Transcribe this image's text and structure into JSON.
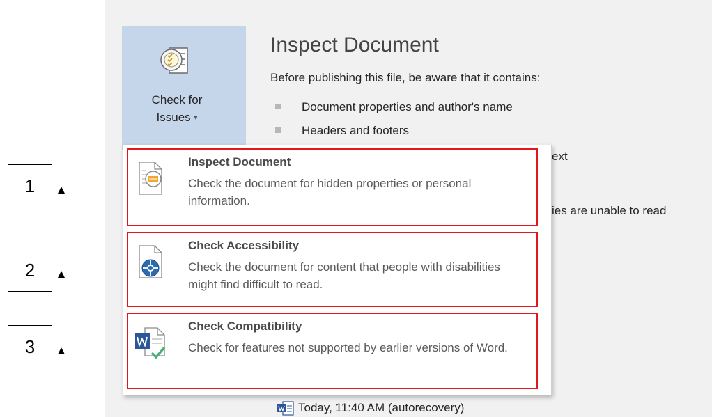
{
  "check_for_issues": {
    "line1": "Check for",
    "line2": "Issues",
    "caret": "▾",
    "icon": "checklist-icon"
  },
  "inspect_section": {
    "title": "Inspect Document",
    "description": "Before publishing this file, be aware that it contains:",
    "bullets": [
      "Document properties and author's name",
      "Headers and footers"
    ],
    "partial_texts": [
      "ext",
      "ies are unable to read"
    ]
  },
  "menu": {
    "items": [
      {
        "title": "Inspect Document",
        "description": "Check the document for hidden properties or personal information.",
        "icon": "inspect-document-icon"
      },
      {
        "title": "Check Accessibility",
        "description": "Check the document for content that people with disabilities might find difficult to read.",
        "icon": "accessibility-icon"
      },
      {
        "title": "Check Compatibility",
        "description": "Check for features not supported by earlier versions of Word.",
        "icon": "word-compatibility-icon"
      }
    ]
  },
  "annotations": [
    "1",
    "2",
    "3"
  ],
  "recovery": {
    "text": "Today, 11:40 AM (autorecovery)",
    "icon": "word-document-icon"
  },
  "colors": {
    "button_bg": "#c5d5ea",
    "highlight_border": "#e2161b",
    "word_blue": "#2b579a",
    "check_green": "#4caf7d"
  }
}
